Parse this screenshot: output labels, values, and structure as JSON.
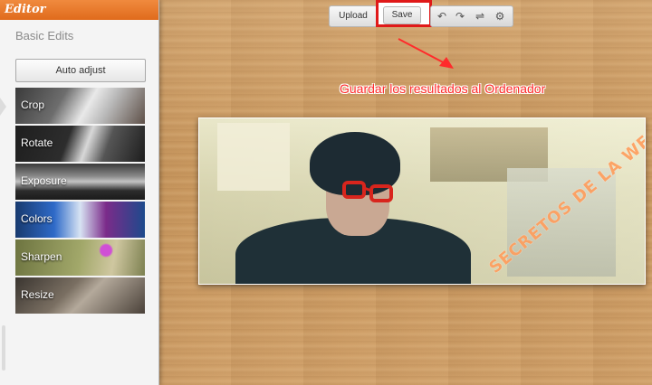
{
  "sidebar": {
    "header": "Editor",
    "section_title": "Basic Edits",
    "auto_adjust": "Auto adjust",
    "tools": [
      {
        "label": "Crop",
        "icon": "scissors-icon"
      },
      {
        "label": "Rotate",
        "icon": "rotate-arrow-icon"
      },
      {
        "label": "Exposure",
        "icon": "window-light-icon"
      },
      {
        "label": "Colors",
        "icon": "color-swatch-icon"
      },
      {
        "label": "Sharpen",
        "icon": "flower-icon"
      },
      {
        "label": "Resize",
        "icon": "heart-frame-icon"
      }
    ]
  },
  "toolbar": {
    "upload": "Upload",
    "save": "Save",
    "icons": [
      "undo-icon",
      "redo-icon",
      "compare-icon",
      "settings-gear-icon"
    ]
  },
  "annotation": {
    "text": "Guardar los resultados al Ordenador",
    "color": "#ff2b2b"
  },
  "photo": {
    "watermark": "SECRETOS DE LA WEB"
  },
  "colors": {
    "header_orange": "#e8772a",
    "highlight_red": "#e01919"
  }
}
